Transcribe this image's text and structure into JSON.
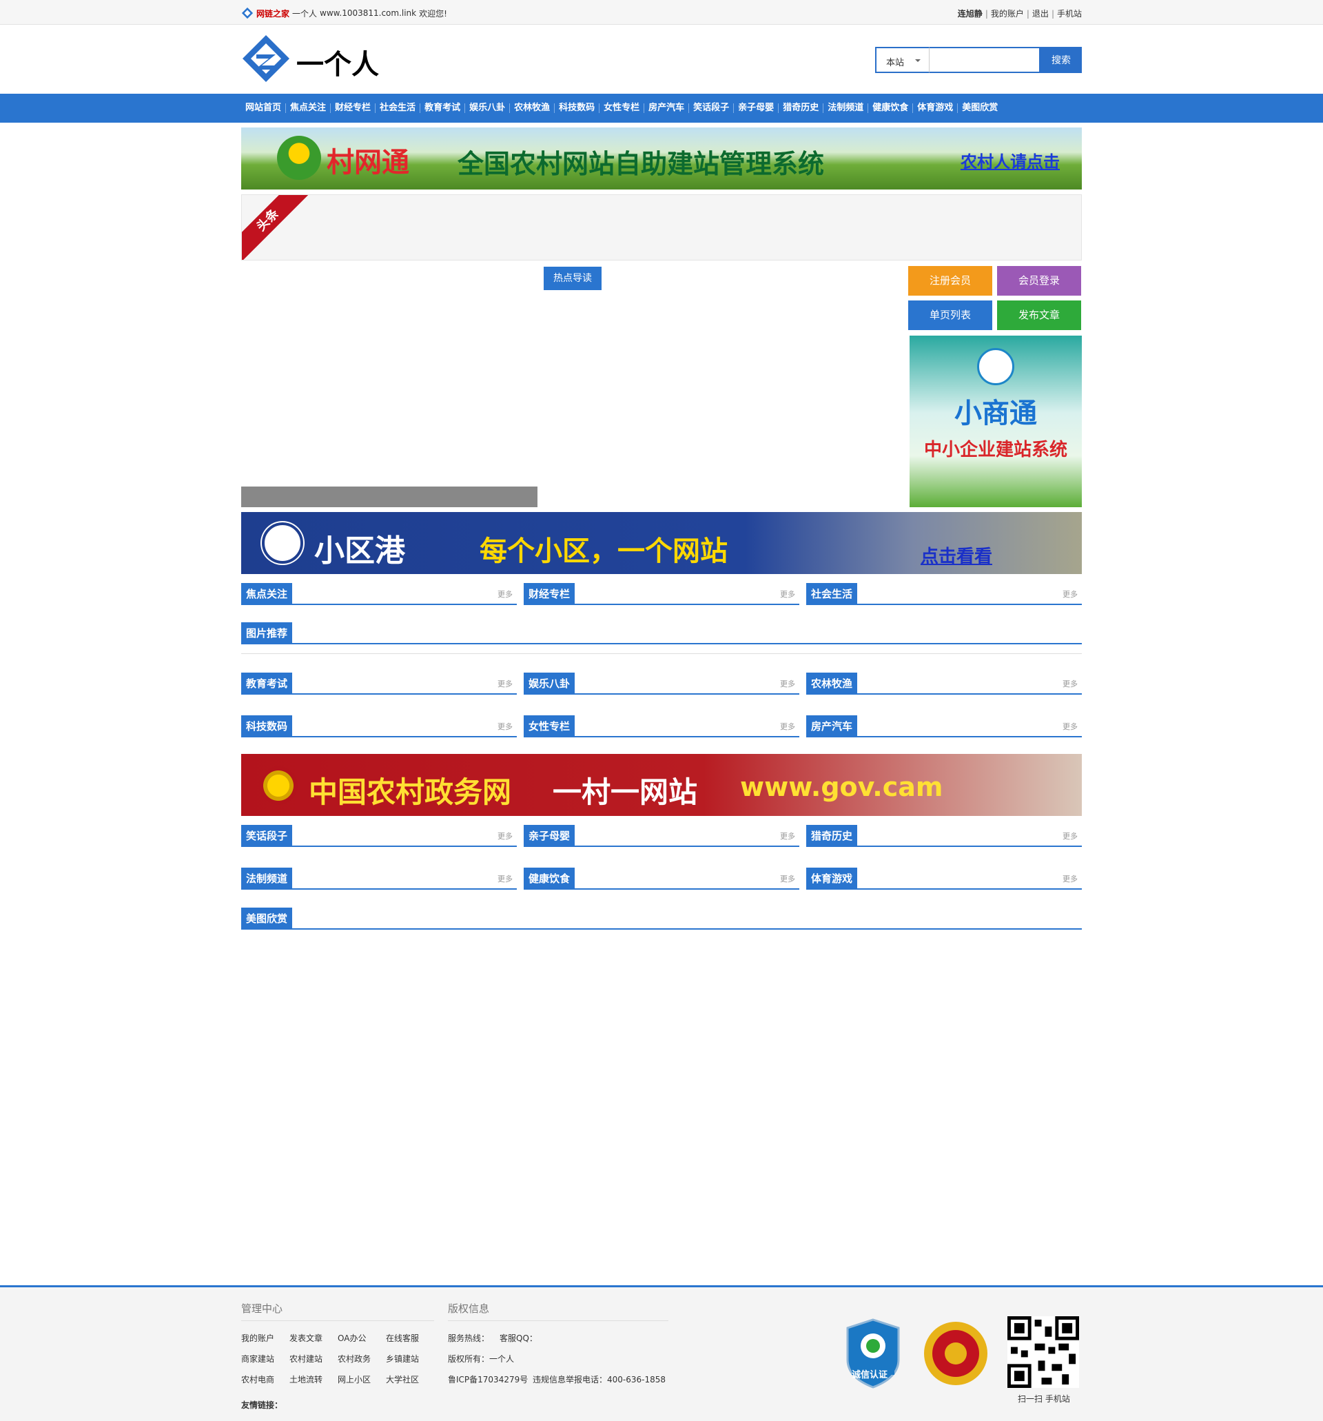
{
  "topbar": {
    "brand": "网链之家",
    "site": "一个人",
    "domain": "www.1003811.com.link",
    "welcome": "欢迎您!",
    "username": "连旭静",
    "links": [
      "我的账户",
      "退出",
      "手机站"
    ]
  },
  "header": {
    "site_name": "一个人",
    "search_scope": "本站",
    "search_placeholder": "",
    "search_button": "搜索"
  },
  "nav": [
    "网站首页",
    "焦点关注",
    "财经专栏",
    "社会生活",
    "教育考试",
    "娱乐八卦",
    "农林牧渔",
    "科技数码",
    "女性专栏",
    "房产汽车",
    "笑话段子",
    "亲子母婴",
    "猎奇历史",
    "法制频道",
    "健康饮食",
    "体育游戏",
    "美图欣赏"
  ],
  "banner1": {
    "t1": "村网通",
    "t2": "全国农村网站自助建站管理系统",
    "t3": "农村人请点击"
  },
  "toutiao_label": "头条",
  "hot_button": "热点导读",
  "side_buttons": [
    "注册会员",
    "会员登录",
    "单页列表",
    "发布文章"
  ],
  "side_ad": {
    "t1": "小商通",
    "t2": "中小企业建站系统"
  },
  "banner2": {
    "t1": "小区港",
    "t2": "每个小区，一个网站",
    "t3": "点击看看"
  },
  "banner3": {
    "t1": "中国农村政务网",
    "t2": "一村一网站",
    "t3": "www.gov.cam"
  },
  "more_label": "更多",
  "sections": {
    "row1": [
      "焦点关注",
      "财经专栏",
      "社会生活"
    ],
    "pics": "图片推荐",
    "row2": [
      "教育考试",
      "娱乐八卦",
      "农林牧渔"
    ],
    "row3": [
      "科技数码",
      "女性专栏",
      "房产汽车"
    ],
    "row4": [
      "笑话段子",
      "亲子母婴",
      "猎奇历史"
    ],
    "row5": [
      "法制频道",
      "健康饮食",
      "体育游戏"
    ],
    "beauty": "美图欣赏"
  },
  "footer": {
    "mgmt_title": "管理中心",
    "mgmt_links": [
      "我的账户",
      "发表文章",
      "OA办公",
      "在线客服",
      "商家建站",
      "农村建站",
      "农村政务",
      "乡镇建站",
      "农村电商",
      "土地流转",
      "网上小区",
      "大学社区"
    ],
    "copy_title": "版权信息",
    "hotline": "服务热线：",
    "qq": "客服QQ：",
    "owner": "版权所有：一个人",
    "icp": "鲁ICP备17034279号",
    "report": "违规信息举报电话：400-636-1858",
    "friend_links": "友情链接：",
    "badge1": "诚信认证",
    "qr_caption": "扫一扫 手机站"
  },
  "colors": {
    "primary": "#2a75cf",
    "orange": "#f39a1b",
    "purple": "#9b59b6",
    "green": "#2eaa3a"
  }
}
